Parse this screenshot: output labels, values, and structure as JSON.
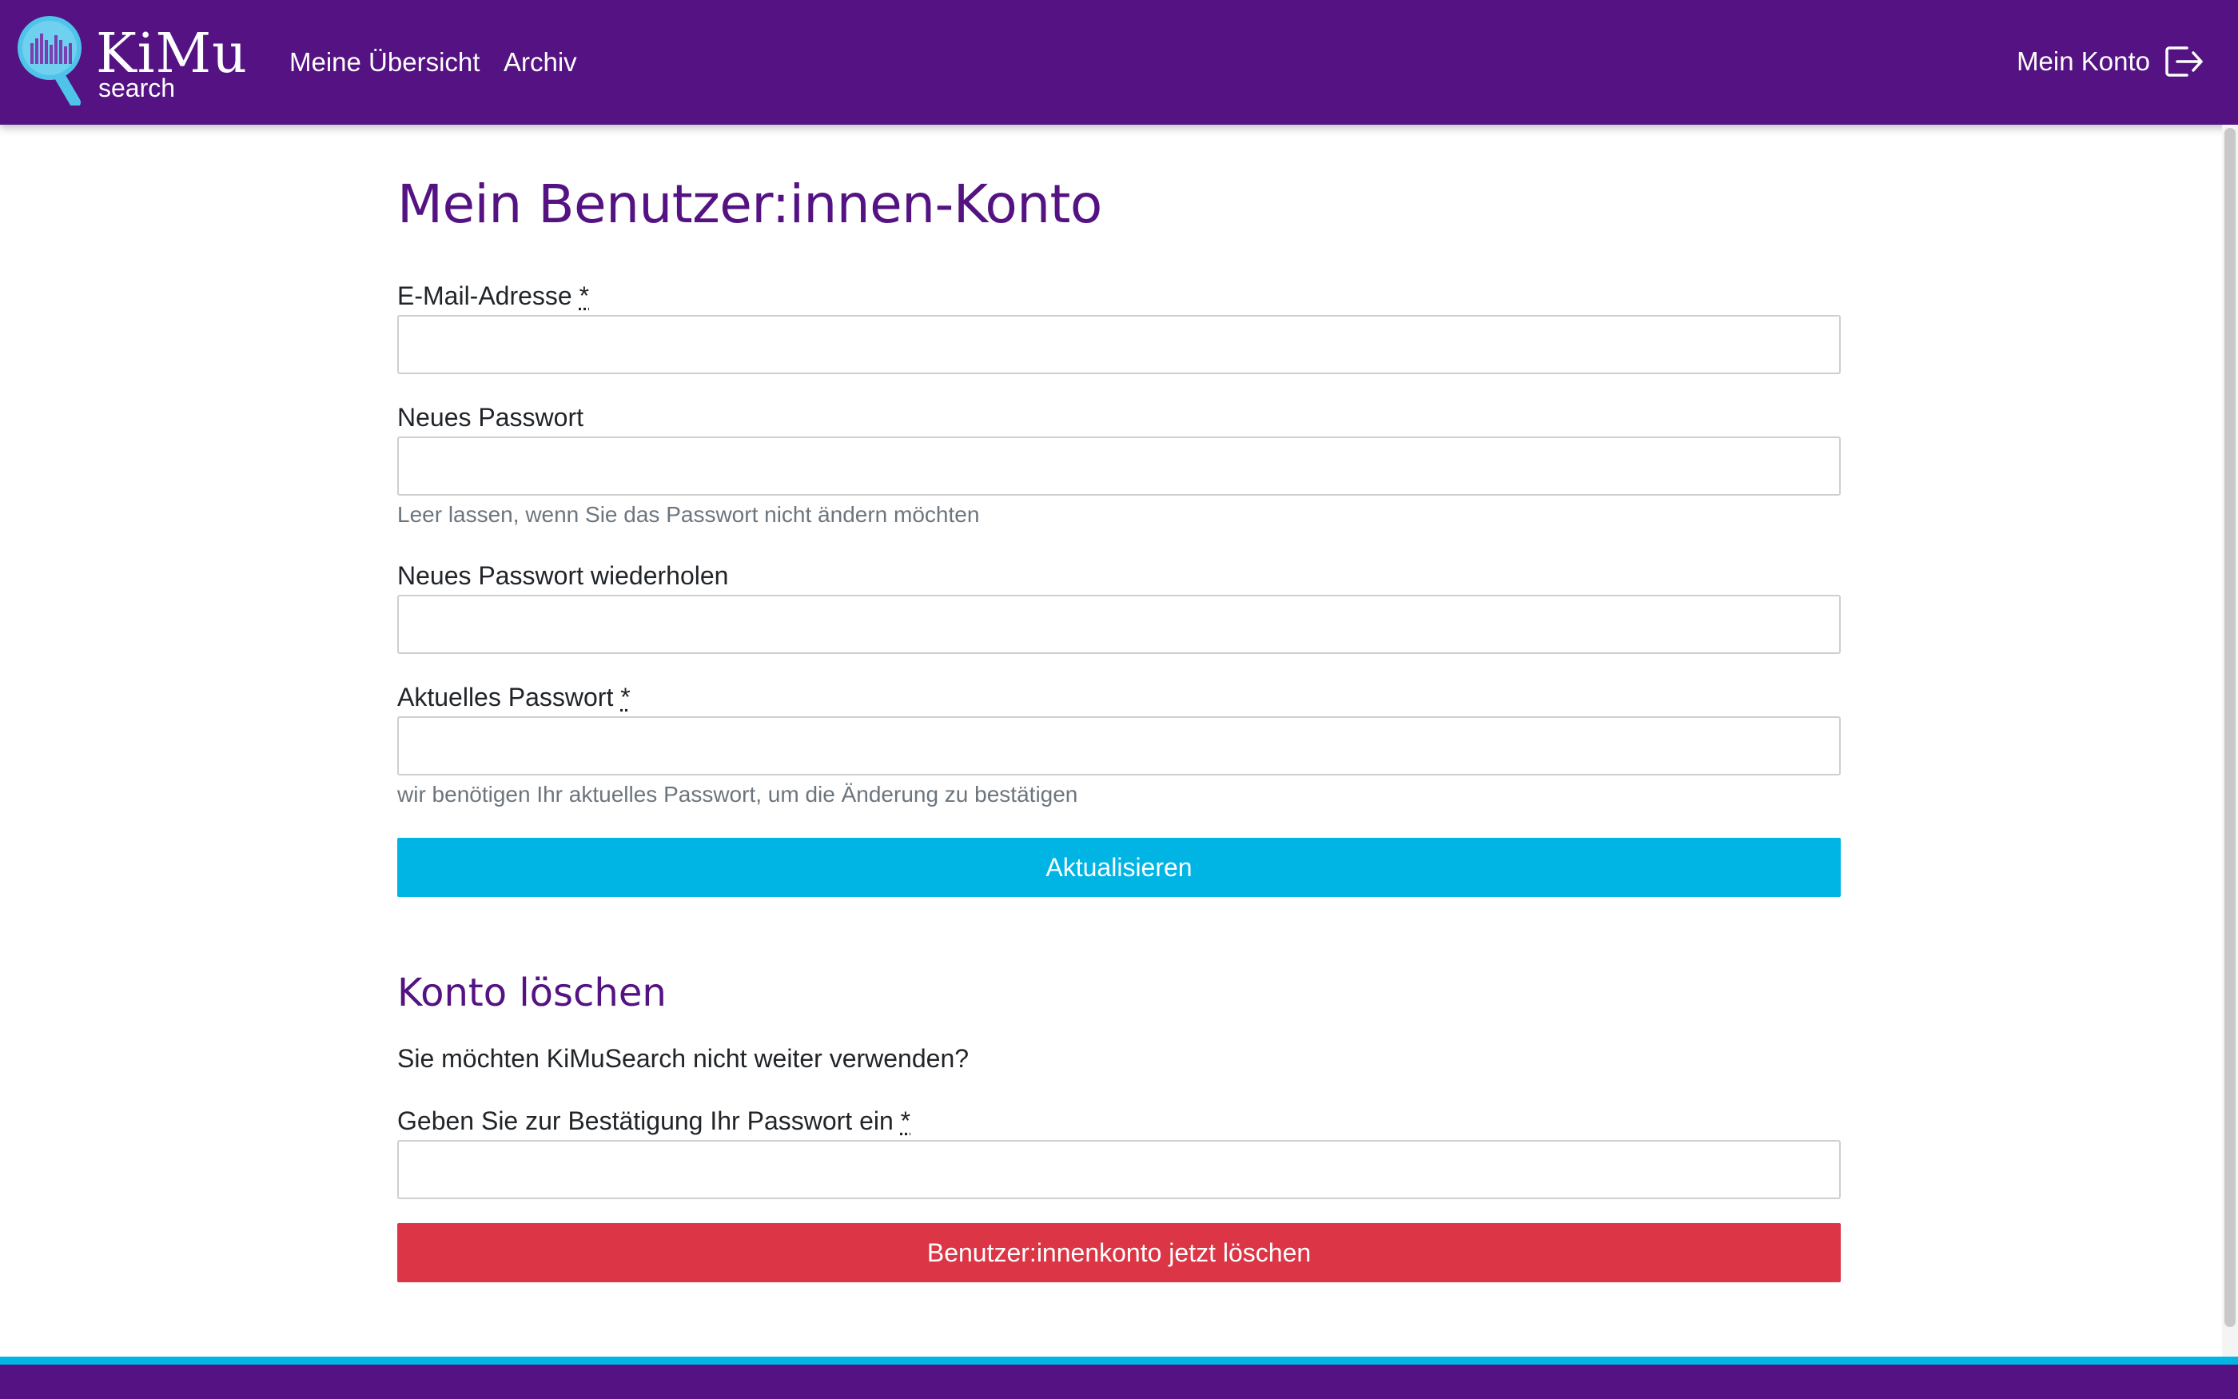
{
  "header": {
    "logo_title": "KiMu",
    "logo_subtitle": "search",
    "nav": [
      {
        "label": "Meine Übersicht"
      },
      {
        "label": "Archiv"
      }
    ],
    "account_label": "Mein Konto",
    "brand_color": "#541282",
    "accent_color": "#00b4e4"
  },
  "page": {
    "title": "Mein Benutzer:innen-Konto",
    "form": {
      "email_label": "E-Mail-Adresse",
      "email_required": "*",
      "email_value": "",
      "new_password_label": "Neues Passwort",
      "new_password_help": "Leer lassen, wenn Sie das Passwort nicht ändern möchten",
      "repeat_password_label": "Neues Passwort wiederholen",
      "current_password_label": "Aktuelles Passwort",
      "current_password_required": "*",
      "current_password_help": "wir benötigen Ihr aktuelles Passwort, um die Änderung zu bestätigen",
      "submit_label": "Aktualisieren"
    },
    "delete": {
      "heading": "Konto löschen",
      "text": "Sie möchten KiMuSearch nicht weiter verwenden?",
      "confirm_label": "Geben Sie zur Bestätigung Ihr Passwort ein",
      "confirm_required": "*",
      "button_label": "Benutzer:innenkonto jetzt löschen",
      "danger_color": "#dc3545"
    }
  }
}
